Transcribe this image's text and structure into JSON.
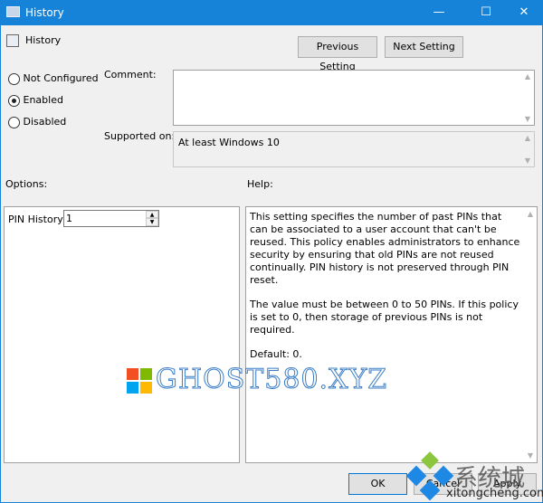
{
  "window": {
    "title": "History",
    "minimize": "—",
    "maximize": "☐",
    "close": "✕"
  },
  "header": {
    "policy_name": "History",
    "prev_label": "Previous Setting",
    "next_label": "Next Setting"
  },
  "state": {
    "options": [
      {
        "label": "Not Configured",
        "selected": false
      },
      {
        "label": "Enabled",
        "selected": true
      },
      {
        "label": "Disabled",
        "selected": false
      }
    ]
  },
  "comment": {
    "label": "Comment:",
    "value": ""
  },
  "supported": {
    "label": "Supported on:",
    "value": "At least Windows 10"
  },
  "options_panel": {
    "label": "Options:",
    "pin_history_label": "PIN History",
    "pin_history_value": "1"
  },
  "help_panel": {
    "label": "Help:",
    "paragraphs": [
      "This setting specifies the number of past PINs that can be associated to a user account that can't be reused. This policy enables administrators to enhance security by ensuring that old PINs are not reused continually. PIN history is not preserved through PIN reset.",
      "The value must be between 0 to 50 PINs. If this policy is set to 0, then storage of previous PINs is not required.",
      "Default: 0."
    ]
  },
  "footer": {
    "ok": "OK",
    "cancel": "Cancel",
    "apply": "Apply"
  },
  "watermarks": {
    "ghost": "GHOST580.XYZ",
    "xtc_cn": "系统城",
    "xtc_url": "xitongcheng.com"
  },
  "colors": {
    "titlebar": "#1683d8"
  }
}
